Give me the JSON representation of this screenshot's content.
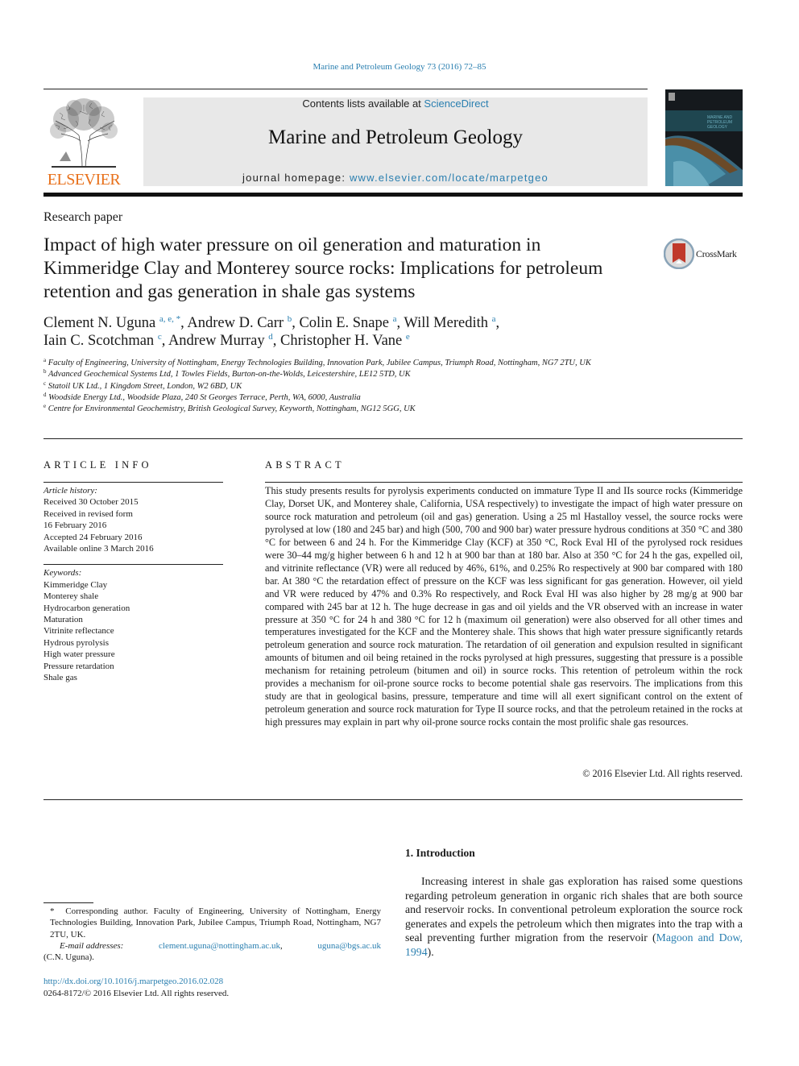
{
  "citation": "Marine and Petroleum Geology 73 (2016) 72–85",
  "publisher": {
    "logo_text": "ELSEVIER",
    "brand_color": "#e8701a"
  },
  "masthead": {
    "contents_prefix": "Contents lists available at ",
    "contents_link": "ScienceDirect",
    "journal_name": "Marine and Petroleum Geology",
    "homepage_prefix": "journal homepage: ",
    "homepage_link": "www.elsevier.com/locate/marpetgeo",
    "link_color": "#2a7fb0"
  },
  "cover": {
    "alt": "Marine and Petroleum Geology journal cover"
  },
  "paper_type": "Research paper",
  "title": "Impact of high water pressure on oil generation and maturation in Kimmeridge Clay and Monterey source rocks: Implications for petroleum retention and gas generation in shale gas systems",
  "crossmark": {
    "label": "CrossMark"
  },
  "authors": [
    {
      "name": "Clement N. Uguna",
      "affil": "a, e, *",
      "sep": ", "
    },
    {
      "name": "Andrew D. Carr",
      "affil": "b",
      "sep": ", "
    },
    {
      "name": "Colin E. Snape",
      "affil": "a",
      "sep": ", "
    },
    {
      "name": "Will Meredith",
      "affil": "a",
      "sep": ","
    },
    {
      "name": "Iain C. Scotchman",
      "affil": "c",
      "sep": ", "
    },
    {
      "name": "Andrew Murray",
      "affil": "d",
      "sep": ", "
    },
    {
      "name": "Christopher H. Vane",
      "affil": "e",
      "sep": ""
    }
  ],
  "affiliations": [
    {
      "key": "a",
      "text": "Faculty of Engineering, University of Nottingham, Energy Technologies Building, Innovation Park, Jubilee Campus, Triumph Road, Nottingham, NG7 2TU, UK"
    },
    {
      "key": "b",
      "text": "Advanced Geochemical Systems Ltd, 1 Towles Fields, Burton-on-the-Wolds, Leicestershire, LE12 5TD, UK"
    },
    {
      "key": "c",
      "text": "Statoil UK Ltd., 1 Kingdom Street, London, W2 6BD, UK"
    },
    {
      "key": "d",
      "text": "Woodside Energy Ltd., Woodside Plaza, 240 St Georges Terrace, Perth, WA, 6000, Australia"
    },
    {
      "key": "e",
      "text": "Centre for Environmental Geochemistry, British Geological Survey, Keyworth, Nottingham, NG12 5GG, UK"
    }
  ],
  "article_info": {
    "heading": "ARTICLE INFO",
    "history_label": "Article history:",
    "history": [
      "Received 30 October 2015",
      "Received in revised form",
      "16 February 2016",
      "Accepted 24 February 2016",
      "Available online 3 March 2016"
    ],
    "keywords_label": "Keywords:",
    "keywords": [
      "Kimmeridge Clay",
      "Monterey shale",
      "Hydrocarbon generation",
      "Maturation",
      "Vitrinite reflectance",
      "Hydrous pyrolysis",
      "High water pressure",
      "Pressure retardation",
      "Shale gas"
    ]
  },
  "abstract": {
    "heading": "ABSTRACT",
    "text": "This study presents results for pyrolysis experiments conducted on immature Type II and IIs source rocks (Kimmeridge Clay, Dorset UK, and Monterey shale, California, USA respectively) to investigate the impact of high water pressure on source rock maturation and petroleum (oil and gas) generation. Using a 25 ml Hastalloy vessel, the source rocks were pyrolysed at low (180 and 245 bar) and high (500, 700 and 900 bar) water pressure hydrous conditions at 350 °C and 380 °C for between 6 and 24 h. For the Kimmeridge Clay (KCF) at 350 °C, Rock Eval HI of the pyrolysed rock residues were 30–44 mg/g higher between 6 h and 12 h at 900 bar than at 180 bar. Also at 350 °C for 24 h the gas, expelled oil, and vitrinite reflectance (VR) were all reduced by 46%, 61%, and 0.25% Ro respectively at 900 bar compared with 180 bar. At 380 °C the retardation effect of pressure on the KCF was less significant for gas generation. However, oil yield and VR were reduced by 47% and 0.3% Ro respectively, and Rock Eval HI was also higher by 28 mg/g at 900 bar compared with 245 bar at 12 h. The huge decrease in gas and oil yields and the VR observed with an increase in water pressure at 350 °C for 24 h and 380 °C for 12 h (maximum oil generation) were also observed for all other times and temperatures investigated for the KCF and the Monterey shale. This shows that high water pressure significantly retards petroleum generation and source rock maturation. The retardation of oil generation and expulsion resulted in significant amounts of bitumen and oil being retained in the rocks pyrolysed at high pressures, suggesting that pressure is a possible mechanism for retaining petroleum (bitumen and oil) in source rocks. This retention of pe­troleum within the rock provides a mechanism for oil-prone source rocks to become potential shale gas reservoirs. The implications from this study are that in geological basins, pressure, temperature and time will all exert significant control on the extent of petroleum generation and source rock maturation for Type II source rocks, and that the petroleum retained in the rocks at high pressures may explain in part why oil-prone source rocks contain the most prolific shale gas resources.",
    "copyright": "© 2016 Elsevier Ltd. All rights reserved."
  },
  "introduction": {
    "heading": "1.  Introduction",
    "text_before_link": "Increasing interest in shale gas exploration has raised some questions regarding petroleum generation in organic rich shales that are both source and reservoir rocks. In conventional petroleum exploration the source rock generates and expels the petroleum which then migrates into the trap with a seal preventing further migration from the reservoir (",
    "ref_link": "Magoon and Dow, 1994",
    "text_after_link": ")."
  },
  "footnote": {
    "star": "*",
    "corresponding": "Corresponding author. Faculty of Engineering, University of Nottingham, Energy Technologies Building, Innovation Park, Jubilee Campus, Triumph Road, Notting­ham, NG7 2TU, UK.",
    "email_label": "E-mail addresses:",
    "emails": [
      "clement.uguna@nottingham.ac.uk",
      "uguna@bgs.ac.uk"
    ],
    "email_owner": "(C.N. Uguna)."
  },
  "doi": {
    "link": "http://dx.doi.org/10.1016/j.marpetgeo.2016.02.028",
    "issn_line": "0264-8172/© 2016 Elsevier Ltd. All rights reserved."
  }
}
